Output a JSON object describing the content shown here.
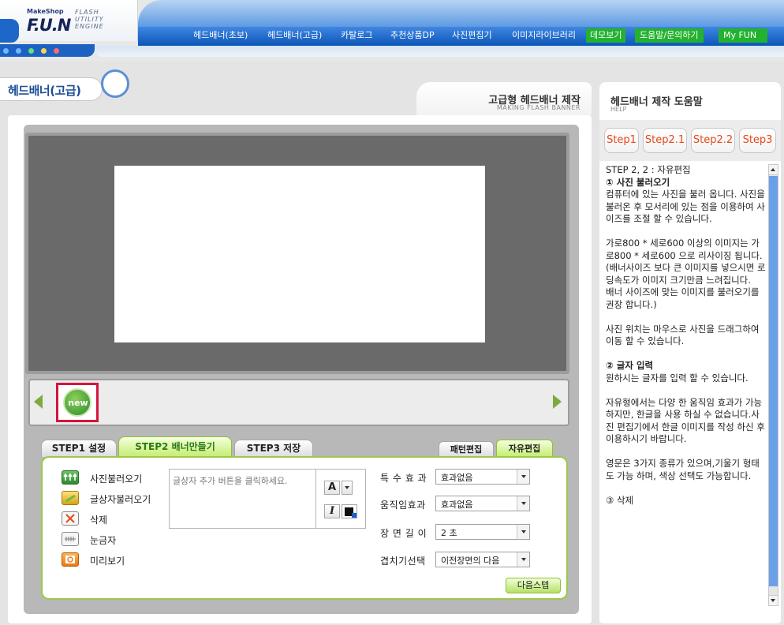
{
  "logo": {
    "maker": "MakeShop",
    "name": "F.U.N",
    "sub1": "FLASH",
    "sub2": "UTILITY",
    "sub3": "ENGINE"
  },
  "nav": {
    "items": [
      {
        "label": "헤드배너(초보)"
      },
      {
        "label": "헤드배너(고급)"
      },
      {
        "label": "카탈로그"
      },
      {
        "label": "추천상품DP"
      },
      {
        "label": "사진편집기"
      },
      {
        "label": "이미지라이브러리"
      },
      {
        "label": "데모보기"
      },
      {
        "label": "도움말/문의하기"
      },
      {
        "label": "My FUN"
      }
    ]
  },
  "page": {
    "title": "헤드배너(고급)",
    "header_title": "고급형 헤드배너 제작",
    "header_sub": "MAKING FLASH BANNER"
  },
  "editor": {
    "thumbnail_label": "new",
    "step_tabs": [
      {
        "label": "STEP1 설정"
      },
      {
        "label": "STEP2 배너만들기"
      },
      {
        "label": "STEP3 저장"
      }
    ],
    "mode_tabs": [
      {
        "label": "패턴편집"
      },
      {
        "label": "자유편집"
      }
    ],
    "tools": [
      {
        "label": "사진불러오기",
        "icon": "photo-load-icon"
      },
      {
        "label": "글상자불러오기",
        "icon": "textbox-icon"
      },
      {
        "label": "삭제",
        "icon": "delete-icon"
      },
      {
        "label": "눈금자",
        "icon": "ruler-icon"
      },
      {
        "label": "미리보기",
        "icon": "preview-icon"
      }
    ],
    "textbox_placeholder": "글상자 추가 버튼을 클릭하세요.",
    "text_tools": {
      "font_label": "A",
      "italic_label": "I"
    },
    "effects": [
      {
        "label": "특 수 효 과",
        "value": "효과없음"
      },
      {
        "label": "움직임효과",
        "value": "효과없음"
      },
      {
        "label": "장 면 길 이",
        "value": "2 초"
      },
      {
        "label": "겹치기선택",
        "value": "이전장면의 다음"
      }
    ],
    "next_button": "다음스텝"
  },
  "help": {
    "title": "헤드배너 제작 도움말",
    "sub": "HELP",
    "steps": [
      {
        "label": "Step1"
      },
      {
        "label": "Step2.1"
      },
      {
        "label": "Step2.2"
      },
      {
        "label": "Step3"
      }
    ],
    "content": [
      {
        "text": "STEP 2, 2 : 자유편집",
        "bold": false
      },
      {
        "text": "① 사진 불러오기",
        "bold": true
      },
      {
        "text": "컴퓨터에 있는 사진을 불러 옵니다. 사진을 불러온 후 모서리에 있는 점을 이용하여 사이즈를 조절 할 수 있습니다.",
        "bold": false
      },
      {
        "text": " ",
        "bold": false
      },
      {
        "text": "가로800 * 세로600 이상의 이미지는 가로800 * 세로600 으로 리사이징 됩니다.",
        "bold": false
      },
      {
        "text": "(배너사이즈 보다 큰 이미지를 넣으시면 로딩속도가 이미지 크기만큼 느려집니다.",
        "bold": false
      },
      {
        "text": "배너 사이즈에 맞는 이미지를 불러오기를 권장 합니다.)",
        "bold": false
      },
      {
        "text": " ",
        "bold": false
      },
      {
        "text": "사진 위치는 마우스로 사진을 드래그하여 이동 할 수 있습니다.",
        "bold": false
      },
      {
        "text": " ",
        "bold": false
      },
      {
        "text": "② 글자 입력",
        "bold": true
      },
      {
        "text": "원하시는 글자를 입력 할 수 있습니다.",
        "bold": false
      },
      {
        "text": " ",
        "bold": false
      },
      {
        "text": "자유형에서는 다양 한 움직임 효과가 가능 하지만, 한글을 사용 하실 수 없습니다.사진 편집기에서 한글 이미지를 작성 하신 후 이용하시기 바랍니다.",
        "bold": false
      },
      {
        "text": " ",
        "bold": false
      },
      {
        "text": "영문은 3가지 종류가 있으며,기울기 형태도 가능 하며, 색상 선택도 가능합니다.",
        "bold": false
      },
      {
        "text": " ",
        "bold": false
      },
      {
        "text": "③ 삭제",
        "bold": false
      }
    ]
  },
  "colors": {
    "accent_blue": "#1d62c3",
    "active_green": "#23b22f",
    "step_orange": "#e8461a",
    "highlight_red": "#d6143c"
  }
}
